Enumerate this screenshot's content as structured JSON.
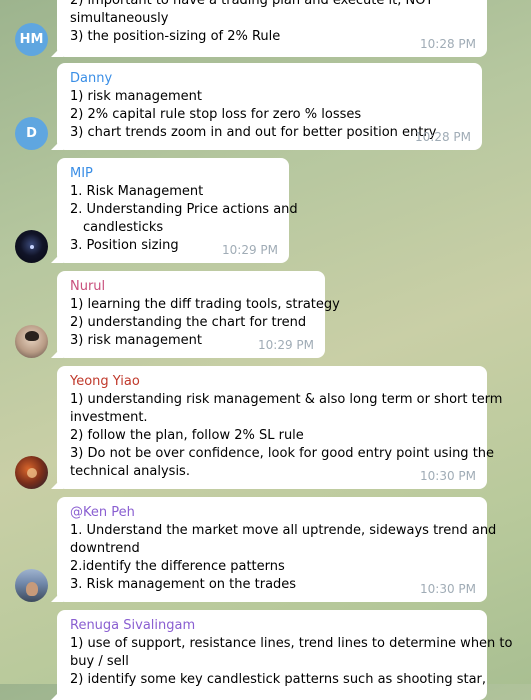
{
  "messages": [
    {
      "avatar": {
        "text": "HM",
        "color": "#5fa6e0"
      },
      "sender": "",
      "sender_color": "#3a8ee6",
      "lines": [
        "2) important to have a trading plan and execute it, NOT",
        "simultaneously",
        "3) the position-sizing of 2% Rule"
      ],
      "time": "10:28 PM"
    },
    {
      "avatar": {
        "text": "D",
        "color": "#5fa6e0"
      },
      "sender": "Danny",
      "sender_color": "#3a8ee6",
      "lines": [
        "1) risk management",
        "2) 2% capital rule stop loss for zero % losses",
        "3) chart trends zoom in and out for better position entry"
      ],
      "time": "10:28 PM"
    },
    {
      "avatar": {
        "text": "",
        "color": "#0b0d1a"
      },
      "sender": "MIP",
      "sender_color": "#3a8ee6",
      "lines": [
        "1. Risk Management",
        "2. Understanding Price actions and",
        "candlesticks",
        "3. Position sizing"
      ],
      "time": "10:29 PM"
    },
    {
      "avatar": {
        "text": "",
        "color": "#c9b8a6"
      },
      "sender": "Nurul",
      "sender_color": "#c94f7c",
      "lines": [
        "1) learning the diff trading tools, strategy",
        "2) understanding the chart for trend",
        "3) risk management"
      ],
      "time": "10:29 PM"
    },
    {
      "avatar": {
        "text": "",
        "color": "#7a3b2a"
      },
      "sender": "Yeong Yiao",
      "sender_color": "#c0392b",
      "lines": [
        "1) understanding risk management & also long term or short term",
        "investment.",
        "2) follow the plan, follow 2% SL rule",
        "3) Do not be over confidence, look for good entry point using the",
        "technical analysis."
      ],
      "time": "10:30 PM"
    },
    {
      "avatar": {
        "text": "",
        "color": "#5b6f8e"
      },
      "sender": "@Ken Peh",
      "sender_color": "#8a5fd1",
      "lines": [
        "1. Understand the market move all uptrende, sideways trend and",
        "downtrend",
        "2.identify the difference patterns",
        "3. Risk management on the trades"
      ],
      "time": "10:30 PM"
    },
    {
      "avatar": {
        "text": "",
        "color": "#ffffff"
      },
      "sender": "Renuga Sivalingam",
      "sender_color": "#8a5fd1",
      "lines": [
        "1) use of support, resistance lines, trend lines to determine when to",
        "buy / sell",
        "2) identify some key candlestick patterns such as shooting star,"
      ],
      "time": ""
    }
  ]
}
